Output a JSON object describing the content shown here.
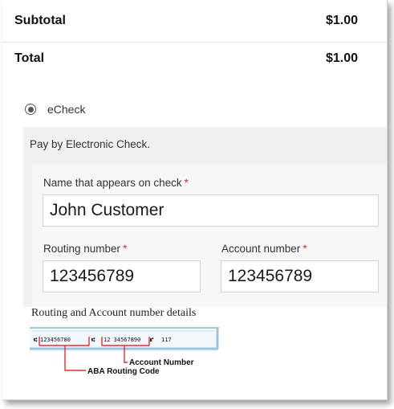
{
  "summary": {
    "subtotal_label": "Subtotal",
    "subtotal_value": "$1.00",
    "total_label": "Total",
    "total_value": "$1.00"
  },
  "payment": {
    "method_label": "eCheck",
    "selected": true,
    "description": "Pay by Electronic Check."
  },
  "form": {
    "name_label": "Name that appears on check",
    "name_value": "John Customer",
    "routing_label": "Routing number",
    "routing_value": "123456789",
    "account_label": "Account number",
    "account_value": "123456789",
    "required_marker": "*"
  },
  "details": {
    "title": "Routing and Account number details",
    "check_routing_digits": "123456780",
    "check_account_digits": "12  34567890",
    "check_suffix": "117",
    "account_caption": "Account Number",
    "routing_caption": "ABA Routing Code"
  },
  "colors": {
    "required": "#c0392b",
    "panel_bg": "#f0f0f0",
    "check_border": "#9cc3dc",
    "callout": "#e03030"
  }
}
